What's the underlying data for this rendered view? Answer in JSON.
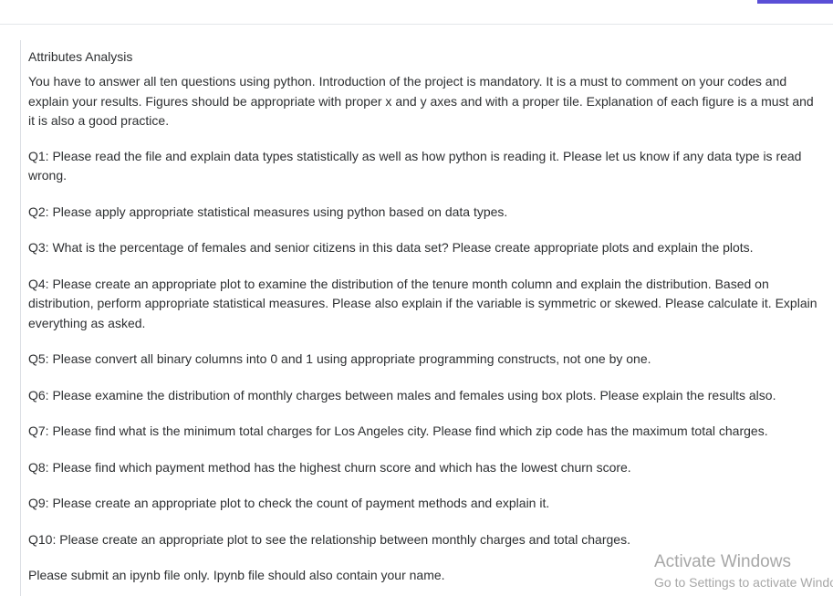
{
  "assignment": {
    "title": "Attributes Analysis",
    "intro": "You have to answer all ten questions using python. Introduction of the project is mandatory. It is a must to comment on your codes and explain your results. Figures should be appropriate with proper x and y axes and with a proper tile. Explanation of each figure is a must and it is also a good practice.",
    "questions": [
      "Q1: Please read the file and explain data types statistically as well as how python is reading it. Please let us know if any data type is read wrong.",
      "Q2: Please apply appropriate statistical measures using python based on data types.",
      "Q3: What is the percentage of females and senior citizens in this data set? Please create appropriate plots and explain the plots.",
      "Q4:  Please create an appropriate plot to examine the distribution of the tenure month column and explain the distribution. Based on distribution, perform appropriate statistical measures. Please also explain if the variable is symmetric or skewed. Please calculate it. Explain everything as asked.",
      "Q5: Please convert all binary columns into 0 and 1 using appropriate programming constructs, not one by one.",
      "Q6: Please examine the distribution of monthly charges between males and females using box plots. Please explain the results also.",
      "Q7: Please find what is the minimum total charges for Los Angeles city. Please find which zip code has the maximum total charges.",
      "Q8: Please find which payment method has the highest churn score and which has the lowest churn score.",
      "Q9: Please create an appropriate plot to check the count of payment methods and explain it.",
      "Q10: Please create an appropriate plot to see the relationship between monthly charges and total charges."
    ],
    "submission_note": "Please submit an ipynb file only. Ipynb file should also contain your name."
  },
  "watermark": {
    "title": "Activate Windows",
    "subtitle": "Go to Settings to activate Windows."
  },
  "colors": {
    "accent": "#5a4fd6",
    "text": "#2d2f31",
    "watermark": "#a7a7a7"
  }
}
